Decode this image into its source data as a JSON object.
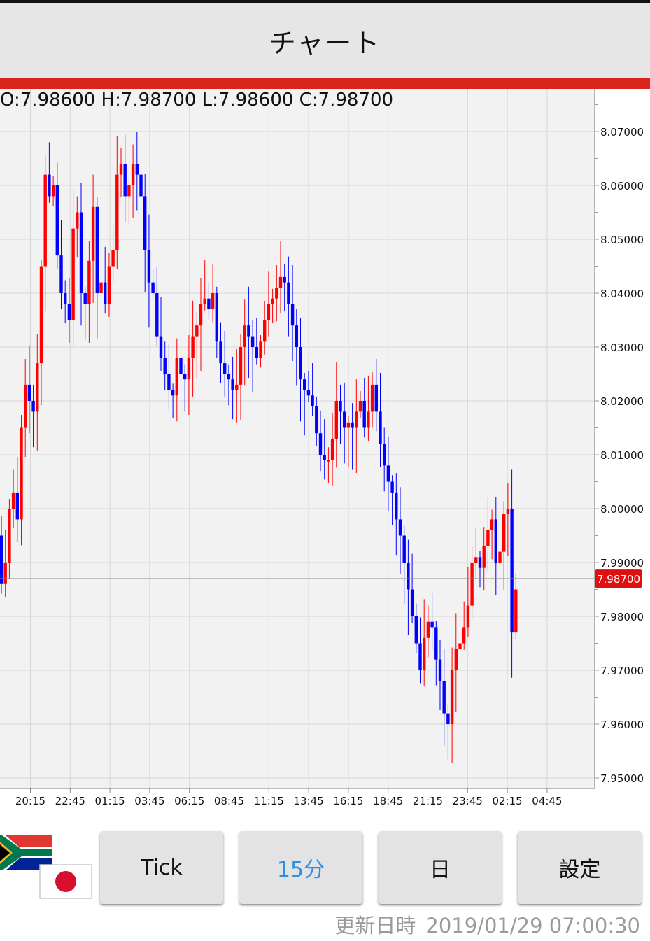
{
  "header": {
    "title": "チャート"
  },
  "ohlc": {
    "text": "O:7.98600 H:7.98700 L:7.98600 C:7.98700"
  },
  "buttons": {
    "tick": "Tick",
    "interval": "15分",
    "day": "日",
    "settings": "設定"
  },
  "footer": {
    "updated_label": "更新日時",
    "updated_value": "2019/01/29 07:00:30"
  },
  "flags": {
    "base": "south-africa-flag-icon",
    "quote": "japan-flag-icon"
  },
  "colors": {
    "up": "#ff0000",
    "down": "#0000ff",
    "accent_bar": "#d9261c",
    "active_button_text": "#2f8fe6",
    "current_price_bg": "#e01010"
  },
  "chart_data": {
    "type": "candlestick",
    "title": "",
    "xlabel": "",
    "ylabel": "",
    "grid": true,
    "ylim": [
      7.945,
      8.082
    ],
    "x_ticks": [
      "20:15",
      "22:45",
      "01:15",
      "03:45",
      "06:15",
      "08:45",
      "11:15",
      "13:45",
      "16:15",
      "18:45",
      "21:15",
      "23:45",
      "02:15",
      "04:45"
    ],
    "y_ticks": [
      "8.07000",
      "8.06000",
      "8.05000",
      "8.04000",
      "8.03000",
      "8.02000",
      "8.01000",
      "8.00000",
      "7.99000",
      "7.98000",
      "7.97000",
      "7.96000",
      "7.95000"
    ],
    "current_price": 7.987,
    "current_price_label": "7.98700",
    "close_series": [
      7.995,
      7.986,
      7.99,
      8.0,
      8.003,
      7.998,
      8.015,
      8.023,
      8.02,
      8.018,
      8.027,
      8.045,
      8.062,
      8.058,
      8.06,
      8.047,
      8.04,
      8.038,
      8.035,
      8.052,
      8.055,
      8.04,
      8.038,
      8.046,
      8.056,
      8.04,
      8.042,
      8.038,
      8.045,
      8.048,
      8.062,
      8.064,
      8.058,
      8.06,
      8.064,
      8.062,
      8.058,
      8.048,
      8.042,
      8.04,
      8.032,
      8.028,
      8.025,
      8.022,
      8.021,
      8.028,
      8.025,
      8.024,
      8.028,
      8.032,
      8.034,
      8.038,
      8.039,
      8.037,
      8.04,
      8.031,
      8.027,
      8.025,
      8.024,
      8.022,
      8.023,
      8.03,
      8.034,
      8.032,
      8.03,
      8.028,
      8.031,
      8.035,
      8.038,
      8.039,
      8.041,
      8.043,
      8.042,
      8.038,
      8.034,
      8.03,
      8.024,
      8.022,
      8.021,
      8.019,
      8.014,
      8.01,
      8.009,
      8.009,
      8.013,
      8.02,
      8.018,
      8.015,
      8.016,
      8.015,
      8.018,
      8.02,
      8.015,
      8.018,
      8.023,
      8.018,
      8.012,
      8.008,
      8.005,
      8.003,
      7.998,
      7.995,
      7.99,
      7.985,
      7.98,
      7.975,
      7.97,
      7.976,
      7.979,
      7.978,
      7.972,
      7.968,
      7.962,
      7.96,
      7.97,
      7.974,
      7.975,
      7.978,
      7.982,
      7.99,
      7.991,
      7.989,
      7.993,
      7.996,
      7.998,
      7.99,
      7.992,
      7.999,
      8.0,
      7.977,
      7.985
    ]
  }
}
